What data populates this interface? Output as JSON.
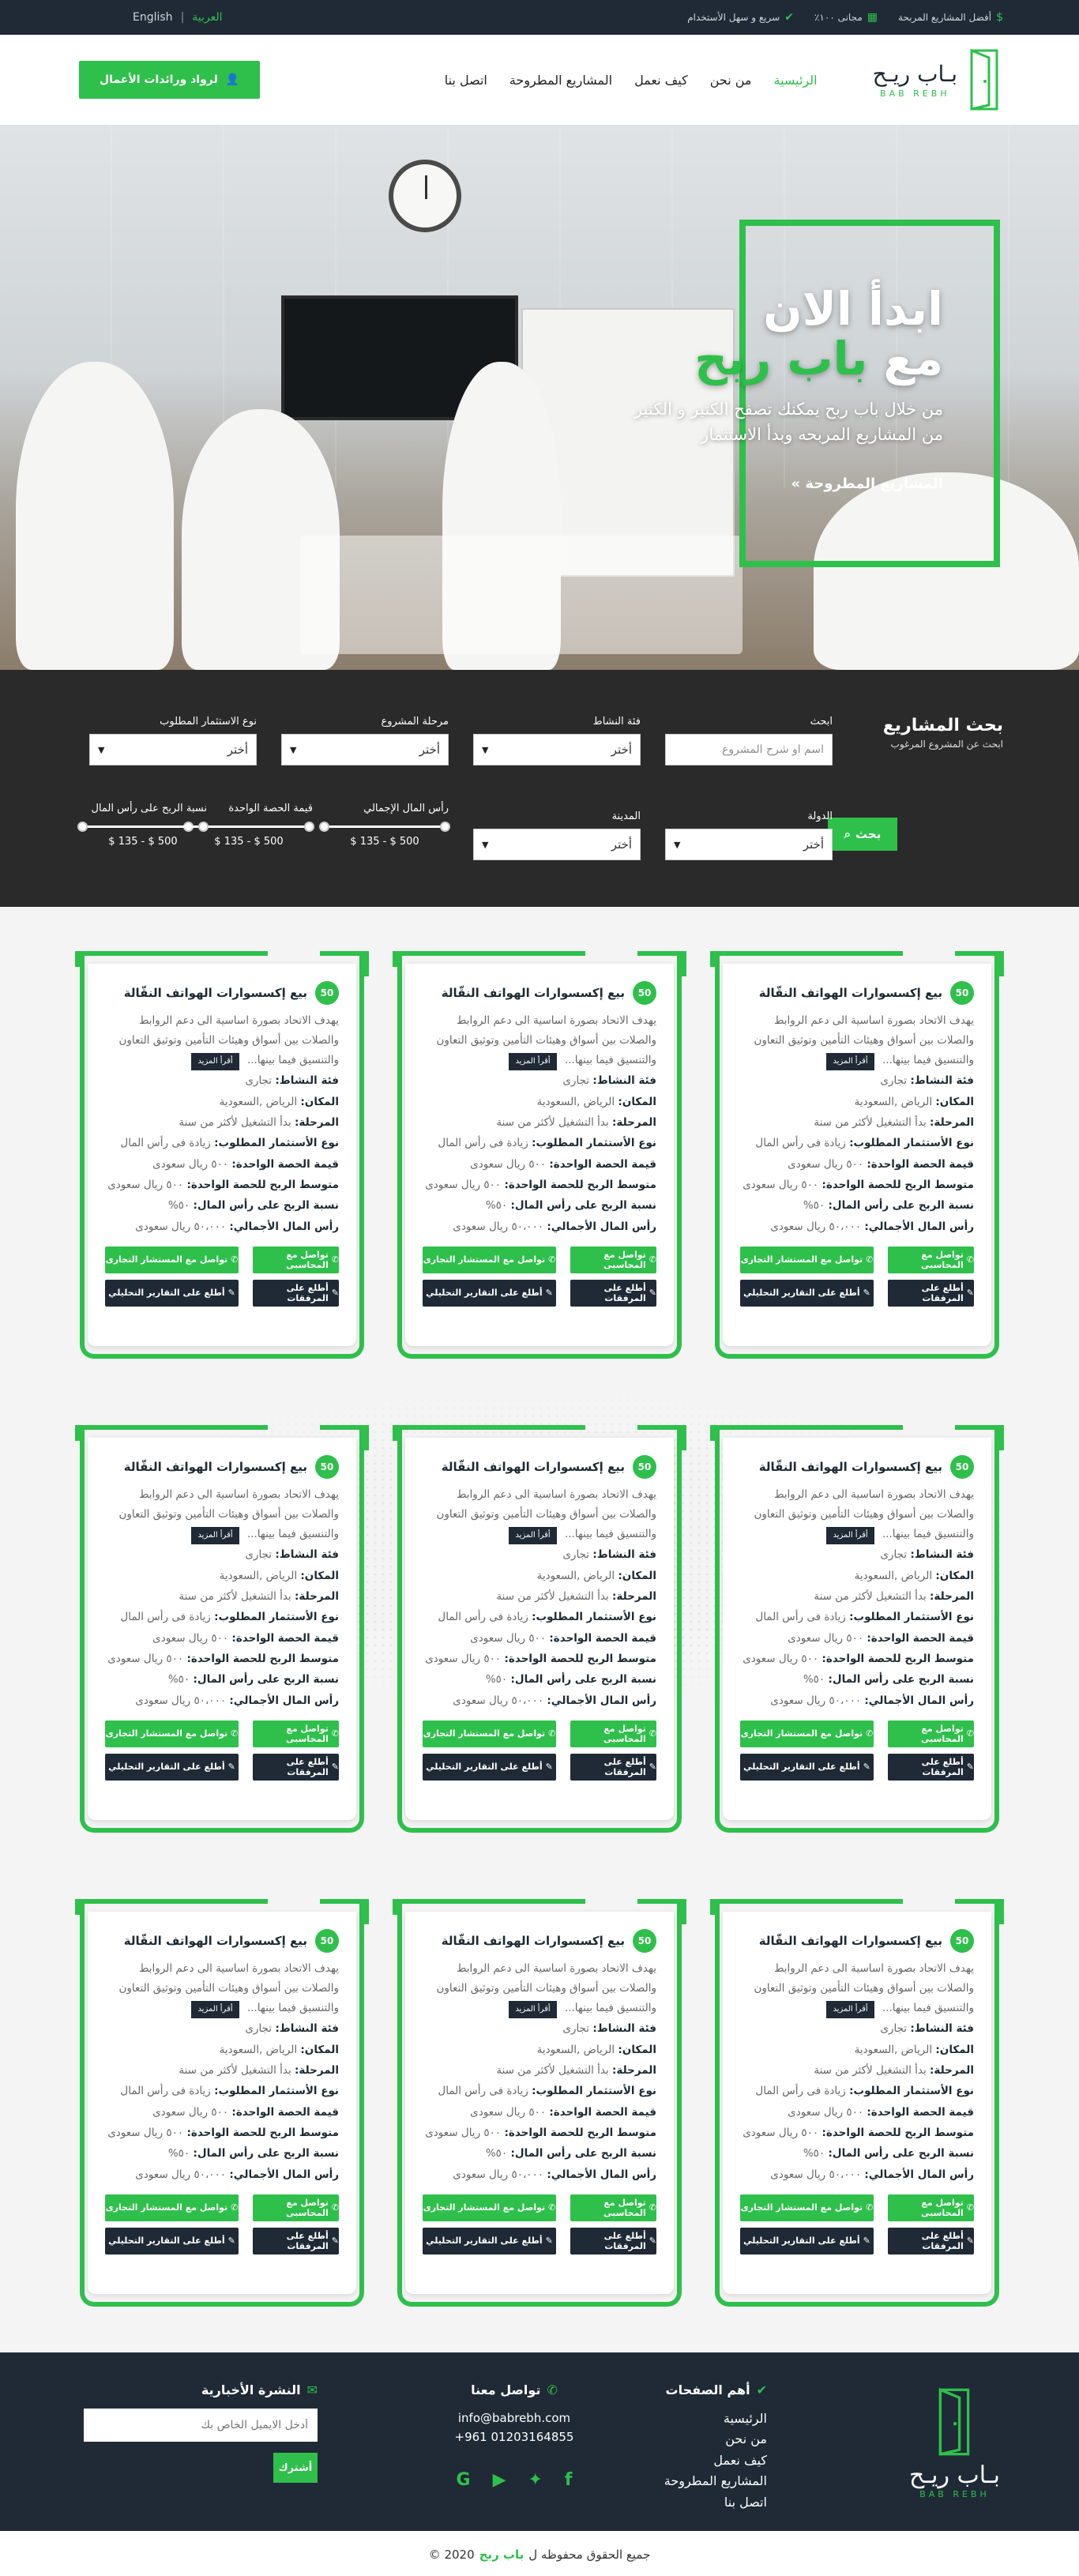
{
  "topbar": {
    "features": [
      {
        "icon": "dollar-icon",
        "label": "أفضل المشاريع المربحة"
      },
      {
        "icon": "percent-icon",
        "label": "مجانى ١٠٠٪"
      },
      {
        "icon": "check-circle-icon",
        "label": "سريع و سهل الأستخدام"
      }
    ],
    "lang_en": "English",
    "lang_ar": "العربية",
    "active_lang": "العربية"
  },
  "header": {
    "logo_ar": "بـاب ريـح",
    "logo_en": "BAB REBH",
    "nav": [
      "الرئيسية",
      "من نحن",
      "كيف نعمل",
      "المشاريع المطروحة",
      "اتصل بنا"
    ],
    "active_nav": "الرئيسية",
    "invest_button": "لرواد ورائدات الأعمال"
  },
  "hero": {
    "title_line1": "ابدأ الان",
    "title_line2_prefix": "مع",
    "title_brand": "باب ربح",
    "subtitle_line1": "من خلال باب ربح يمكنك تصفح الكثير و الكثير",
    "subtitle_line2": "من المشاريع المربحه وبدأ الاستثمار",
    "cta": "المشاريع المطروحة »"
  },
  "search": {
    "title": "بحث المشاريع",
    "subtitle": "ابحث عن المشروع المرغوب",
    "fields": {
      "query": {
        "label": "ابحث",
        "placeholder": "اسم او شرح المشروع"
      },
      "activity": {
        "label": "فئة النشاط",
        "value": "أختر"
      },
      "stage": {
        "label": "مرحلة المشروع",
        "value": "أختر"
      },
      "invest_type": {
        "label": "نوع الاستثمار المطلوب",
        "value": "أختر"
      },
      "country": {
        "label": "الدولة",
        "value": "أختر"
      },
      "city": {
        "label": "المدينة",
        "value": "أختر"
      }
    },
    "button": "بحث",
    "ranges": [
      {
        "label": "رأس المال الإجمالي",
        "value": "500 $ - 135 $",
        "min": 0.0,
        "max": 1.0
      },
      {
        "label": "قيمة الحصة الواحدة",
        "value": "500 $ - 135 $",
        "min": 0.0,
        "max": 1.0
      },
      {
        "label": "نسبة الربح على رأس المال",
        "value": "500 $ - 135 $",
        "min": 0.0,
        "max": 1.0
      }
    ]
  },
  "project": {
    "badge": "50",
    "name": "بيع إكسسوارات الهواتف النقّالة",
    "desc": "يهدف الاتحاد بصورة اساسية الى دعم الروابط والصلات بين أسواق وهيئات التأمين وتوثيق التعاون والتنسيق فيما بينها...",
    "read_more": "أقرأ المزيد",
    "rows": [
      {
        "k": "فئة النشاط:",
        "v": "تجارى"
      },
      {
        "k": "المكان:",
        "v": "الرياض ,السعودية"
      },
      {
        "k": "المرحلة:",
        "v": "بدأ التشغيل لأكثر من سنة"
      },
      {
        "k": "نوع الأستثمار المطلوب:",
        "v": "زيادة فى رأس المال"
      },
      {
        "k": "قيمة الحصة الواحدة:",
        "v": "٥٠٠ ريال سعودى"
      },
      {
        "k": "متوسط الربح للحصة الواحدة:",
        "v": "٥٠٠ ريال سعودى"
      },
      {
        "k": "نسبة الربح على رأس المال:",
        "v": "٥٠%"
      },
      {
        "k": "رأس المال الأجمالي:",
        "v": "٥٠،٠٠٠ ريال سعودى"
      }
    ],
    "btn_accountant": "تواصل مع المحاسبى",
    "btn_consultant": "تواصل مع المستشار التجارى",
    "btn_attachments": "أطلع على المرفقات",
    "btn_reports": "أطلع على التقارير التحليلي"
  },
  "footer": {
    "logo_ar": "بـاب ريـح",
    "logo_en": "BAB REBH",
    "pages_title": "أهم الصفحات",
    "pages": [
      "الرئيسية",
      "من نحن",
      "كيف نعمل",
      "المشاريع المطروحة",
      "اتصل بنا"
    ],
    "contact_title": "تواصل معنا",
    "email": "info@babrebh.com",
    "phone": "+961 01203164855",
    "newsletter_title": "النشرة الأخبارية",
    "newsletter_placeholder": "أدخل الايميل الخاص بك",
    "subscribe": "أشترك"
  },
  "copyright": {
    "prefix": "جميع الحقوق محفوظه ل",
    "brand": "باب ربح",
    "year": "2020 ©"
  },
  "colors": {
    "accent": "#2ec04b",
    "dark": "#1f2a36",
    "search_bg": "#2a2a2a"
  }
}
